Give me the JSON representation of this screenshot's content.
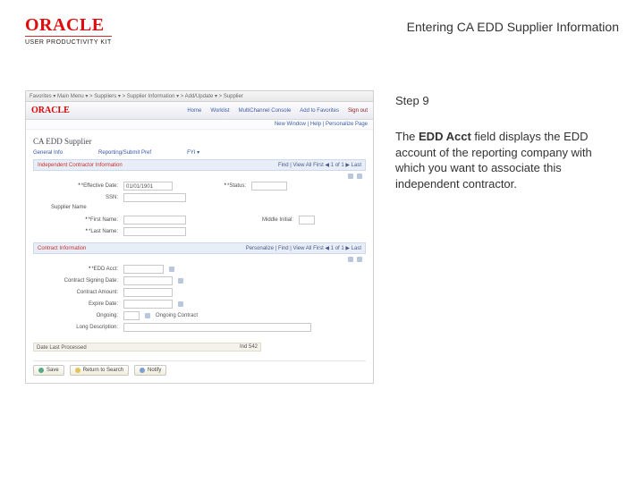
{
  "brand": {
    "logo": "ORACLE",
    "kit": "USER PRODUCTIVITY KIT"
  },
  "doc_title": "Entering CA EDD Supplier Information",
  "step": {
    "label": "Step 9"
  },
  "instruction": {
    "lead": "The ",
    "bold": "EDD Acct",
    "rest": " field displays the EDD account of the reporting company with which you want to associate this independent contractor."
  },
  "ss": {
    "breadcrumb": "Favorites ▾   Main Menu ▾   > Suppliers ▾   > Supplier Information ▾   > Add/Update ▾   > Supplier",
    "brand": "ORACLE",
    "nav": [
      "Home",
      "Worklist",
      "MultiChannel Console",
      "Add to Favorites",
      "Sign out"
    ],
    "subline": "New Window | Help | Personalize Page",
    "page_title": "CA EDD Supplier",
    "row1": {
      "c1": "General Info",
      "c2": "Reporting/Submit Pref",
      "c3": "FYI ▾"
    },
    "sec1": {
      "title": "Independent Contractor Information",
      "tools": "Find | View All    First  ◀ 1 of 1 ▶  Last"
    },
    "fields": {
      "l1": "*Effective Date:",
      "v1": "01/01/1901",
      "l2": "*Status:",
      "ssn": "SSN:",
      "supplier_name_lbl": "Supplier Name",
      "first_name_lbl": "*First Name:",
      "mi_lbl": "Middle Initial:",
      "last_name_lbl": "*Last Name:"
    },
    "contract": {
      "title": "Contract Information",
      "tools": "Personalize | Find | View All    First  ◀ 1 of 1 ▶  Last",
      "edd_lbl": "*EDD Acct:",
      "edd_val": "",
      "sign_lbl": "Contract Signing Date:",
      "amt_lbl": "Contract Amount:",
      "exp_lbl": "Expire Date:",
      "ong_lbl": "Ongoing:",
      "ong_val": "Ongoing Contract",
      "desc_lbl": "Long Description:"
    },
    "trigger": {
      "label": "Date Last Processed",
      "val": "Ind 542"
    },
    "buttons": {
      "save": "Save",
      "ret": "Return to Search",
      "notify": "Notify"
    }
  }
}
